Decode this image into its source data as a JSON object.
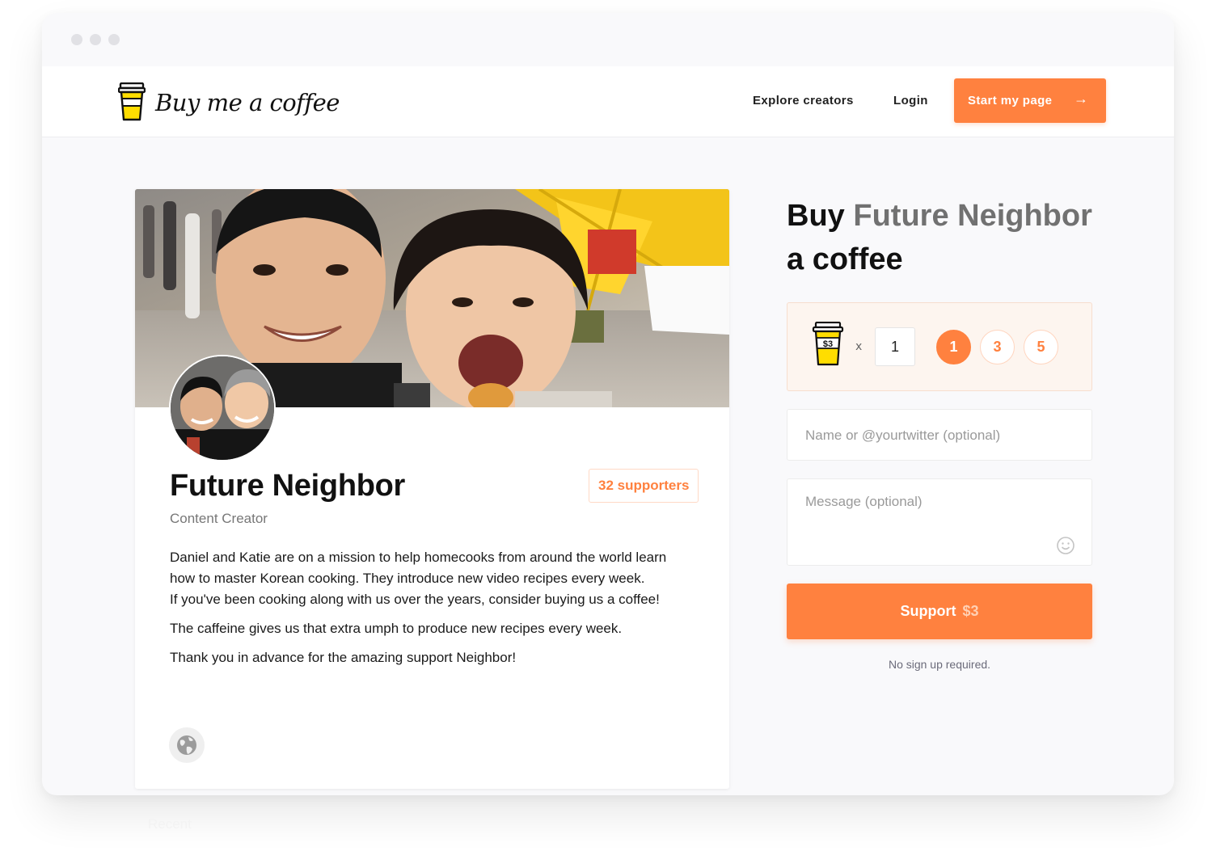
{
  "nav": {
    "logo_text": "Buy me a coffee",
    "explore_label": "Explore creators",
    "login_label": "Login",
    "start_label": "Start my page",
    "start_icon": "arrow-right-icon"
  },
  "profile": {
    "name": "Future Neighbor",
    "role": "Content Creator",
    "supporters": "32 supporters",
    "bio": [
      "Daniel and Katie are on a mission to help homecooks from around the world learn how to master Korean cooking. They introduce new video recipes every week.\nIf you've been cooking along with us over the years, consider buying us a coffee!",
      "The caffeine gives us that extra umph to produce new recipes every week.",
      "Thank you in advance for the amazing support Neighbor!"
    ],
    "website_icon": "globe-icon"
  },
  "ghost_text": "Recent",
  "support": {
    "heading": {
      "prefix": "Buy ",
      "creator": "Future Neighbor",
      "suffix": " a coffee"
    },
    "unit_price_label": "$3",
    "times": "x",
    "quantity": "1",
    "amount_options": [
      "1",
      "3",
      "5"
    ],
    "selected_amount": "1",
    "name_placeholder": "Name or @yourtwitter (optional)",
    "message_placeholder": "Message (optional)",
    "emoji_icon": "smiley-icon",
    "button_label": "Support",
    "button_price": "$3",
    "note": "No sign up required."
  },
  "colors": {
    "accent": "#ff813f",
    "cup_yellow": "#ffdd00",
    "page_bg": "#f9f9fb"
  }
}
